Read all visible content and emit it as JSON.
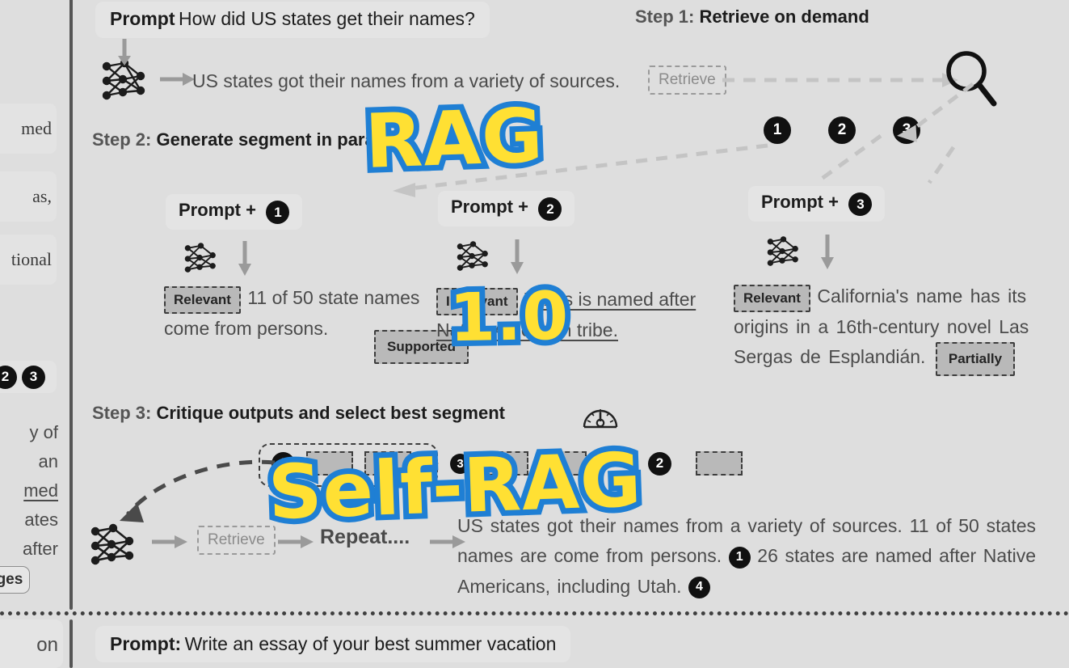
{
  "figure": {
    "background_color": "#dedede",
    "graffiti_fill": "#ffe033",
    "graffiti_stroke": "#1f7fd4"
  },
  "left_column": {
    "clipped_chips": [
      "med",
      "as,",
      "tional"
    ],
    "badges": [
      "2",
      "3"
    ],
    "clipped_lines": [
      "y of",
      "an",
      "med",
      "ates",
      "after"
    ],
    "button_label": "ages",
    "bottom_clipped": "on"
  },
  "top_prompt": {
    "label": "Prompt",
    "text": "How did US states get their names?"
  },
  "step1": {
    "lead": "Step 1:",
    "title": "Retrieve on demand",
    "model_output": "US states got their names from a variety of sources.",
    "retrieve_token": "Retrieve",
    "doc_badges": [
      "1",
      "2",
      "3"
    ],
    "search_icon": "magnifier-icon"
  },
  "step2": {
    "lead": "Step 2:",
    "title": "Generate segment in",
    "title_occluded_tail": "parallel",
    "columns": [
      {
        "header_label": "Prompt +",
        "header_badge": "1",
        "relevance_token": "Relevant",
        "text": "11 of 50 state names come from persons.",
        "support_token": "Supported",
        "underlined": false
      },
      {
        "header_label": "Prompt +",
        "header_badge": "2",
        "relevance_token": "Irrelevant",
        "text": "Texas is named after Native American tribe.",
        "support_token": "",
        "underlined": true
      },
      {
        "header_label": "Prompt +",
        "header_badge": "3",
        "relevance_token": "Relevant",
        "text": "California's name has its origins in a 16th-century novel Las Sergas de Esplandián.",
        "support_token": "Partially",
        "underlined": false
      }
    ]
  },
  "step3": {
    "lead": "Step 3:",
    "title": "Critique outputs and select best segment",
    "gauge_icon": "gauge-icon",
    "critique_row": {
      "group1_badge": "1",
      "group3_badge": "3",
      "group2_badge": "2",
      "boxes": 5
    },
    "pipeline": {
      "nn_icon": "neural-network-icon",
      "retrieve_token": "Retrieve",
      "repeat_label": "Repeat...."
    },
    "final_answer_part1": "US states got their names from a variety of sources. 11 of 50 states names are come from persons.",
    "final_badge1": "1",
    "final_answer_part2": "26 states are named after Native Americans, including Utah.",
    "final_badge2": "4"
  },
  "graffiti": {
    "rag": "RAG",
    "score": "1.0",
    "self_rag": "Self-RAG"
  },
  "bottom_prompt": {
    "label": "Prompt:",
    "text": "Write an essay of your best summer vacation"
  }
}
